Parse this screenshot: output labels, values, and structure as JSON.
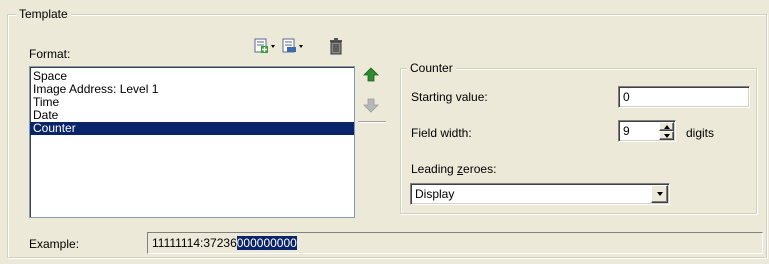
{
  "template_group": {
    "title": "Template"
  },
  "format": {
    "label": "Format:",
    "items": [
      "Space",
      "Image Address: Level 1",
      "Time",
      "Date",
      "Counter"
    ],
    "selected_index": 4
  },
  "toolbar": {
    "add_icon": "add-item-icon",
    "edit_icon": "edit-item-icon",
    "delete_icon": "trash-icon"
  },
  "move": {
    "up_icon": "arrow-up-icon",
    "down_icon": "arrow-down-icon"
  },
  "counter_group": {
    "title": "Counter",
    "starting_value_label": "Starting value:",
    "starting_value": "0",
    "field_width_label": "Field width:",
    "field_width_value": "9",
    "digits_label": "digits",
    "leading_zeroes_label_pre": "Leading ",
    "leading_zeroes_label_u": "z",
    "leading_zeroes_label_post": "eroes:",
    "leading_zeroes_value": "Display"
  },
  "example": {
    "label": "Example:",
    "value_plain": "11111114:37236",
    "value_selected": "000000000"
  },
  "colors": {
    "background": "#ece9d8",
    "selection": "#0a246a",
    "arrow_green": "#2e8b2e",
    "arrow_gray": "#a8a8a8"
  }
}
